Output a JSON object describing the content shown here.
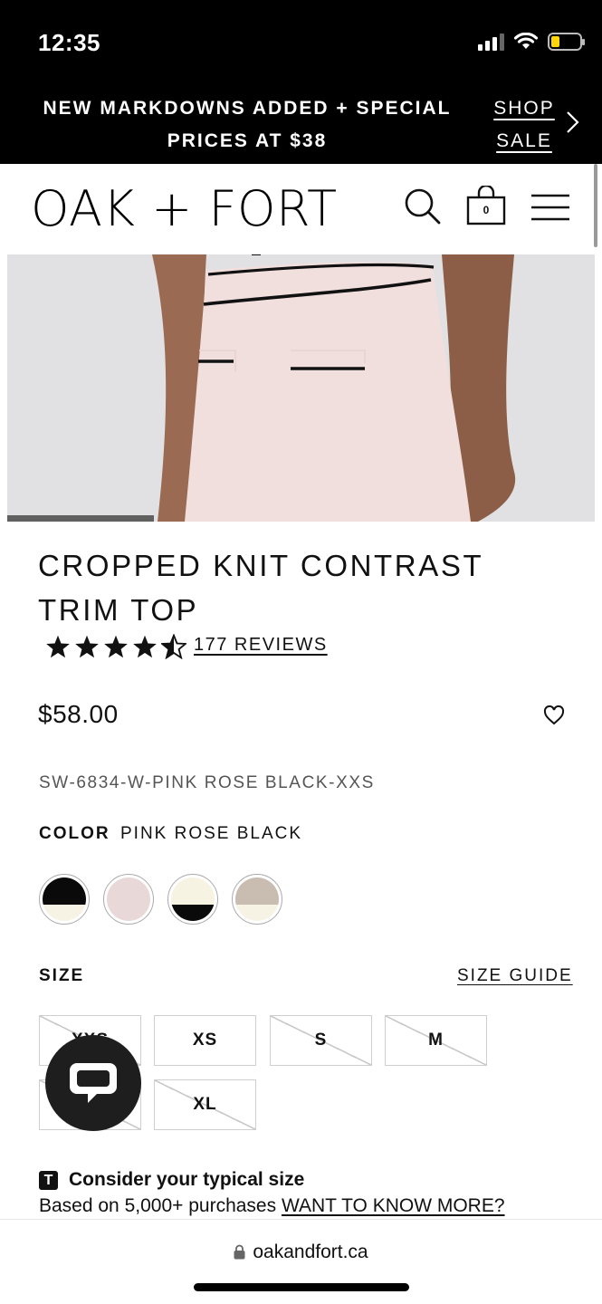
{
  "status_bar": {
    "time": "12:35"
  },
  "promo": {
    "line1": "NEW MARKDOWNS ADDED + SPECIAL",
    "line2": "PRICES AT $38",
    "link_line1": "SHOP",
    "link_line2": "SALE"
  },
  "header": {
    "logo": "OAK + FORT",
    "cart_count": "0",
    "icons": [
      "search-icon",
      "cart-icon",
      "menu-icon"
    ]
  },
  "product": {
    "title": "CROPPED KNIT CONTRAST TRIM TOP",
    "rating": 4.5,
    "reviews_label": "177 REVIEWS",
    "price": "$58.00",
    "sku": "SW-6834-W-PINK ROSE BLACK-XXS",
    "color_label": "COLOR",
    "color_value": "PINK ROSE BLACK",
    "swatches": [
      {
        "name": "black-cream",
        "top": "#0a0a0a",
        "bottom": "#f6f2e4"
      },
      {
        "name": "pink-rose-black",
        "top": "#e8d8d8",
        "bottom": "#e8d8d8"
      },
      {
        "name": "cream-black",
        "top": "#f7f3e3",
        "bottom": "#0a0a0a"
      },
      {
        "name": "taupe-cream",
        "top": "#c9bcb0",
        "bottom": "#f6f2e4"
      }
    ],
    "size_label": "SIZE",
    "size_guide": "SIZE GUIDE",
    "sizes": [
      {
        "label": "XXS",
        "available": false
      },
      {
        "label": "XS",
        "available": true
      },
      {
        "label": "S",
        "available": false
      },
      {
        "label": "M",
        "available": false
      },
      {
        "label": "L",
        "available": false
      },
      {
        "label": "XL",
        "available": false
      }
    ]
  },
  "fit_tip": {
    "icon_letter": "T",
    "title": "Consider your typical size",
    "body": "Based on 5,000+ purchases ",
    "link": "WANT TO KNOW MORE?"
  },
  "browser": {
    "url": "oakandfort.ca"
  },
  "colors": {
    "brand": "#000000",
    "background": "#ffffff",
    "image_bg": "#e0e0e2",
    "garment": "#f0dede"
  }
}
